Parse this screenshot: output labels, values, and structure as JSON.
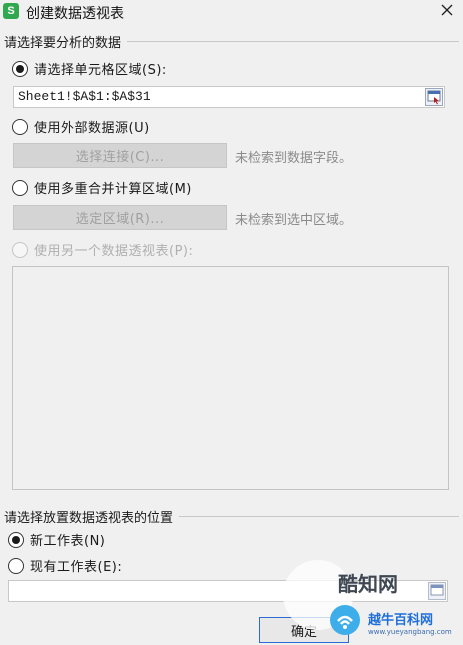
{
  "window": {
    "icon_glyph": "S",
    "title": "创建数据透视表",
    "close_icon": "close-icon"
  },
  "source_section": {
    "header": "请选择要分析的数据",
    "select_range_label": "请选择单元格区域(S):",
    "range_value": "Sheet1!$A$1:$A$31",
    "external_label": "使用外部数据源(U)",
    "choose_connection_button": "选择连接(C)...",
    "no_fields_hint": "未检索到数据字段。",
    "multi_range_label": "使用多重合并计算区域(M)",
    "choose_range_button": "选定区域(R)...",
    "no_range_hint": "未检索到选中区域。",
    "other_pivot_label": "使用另一个数据透视表(P):"
  },
  "location_section": {
    "header": "请选择放置数据透视表的位置",
    "new_sheet_label": "新工作表(N)",
    "existing_sheet_label": "现有工作表(E):",
    "existing_value": ""
  },
  "buttons": {
    "ok_label": "确定"
  },
  "watermark": {
    "text1": "酷知网",
    "text2": "越牛百科网",
    "text3": "www.yueyangbang.com"
  },
  "colors": {
    "app_icon": "#2fa84f",
    "ok_border": "#2b6cd4",
    "watermark_blue": "#1e6fd9"
  }
}
